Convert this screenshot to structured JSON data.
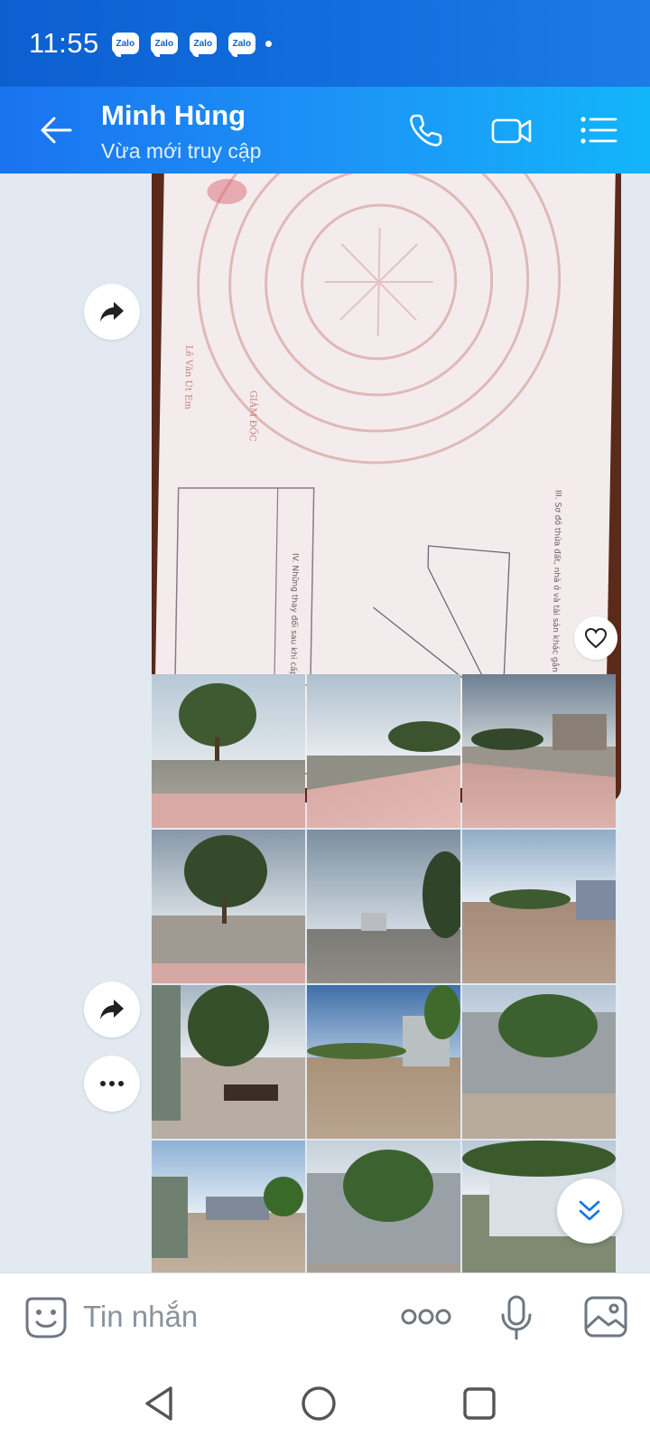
{
  "status_bar": {
    "time": "11:55",
    "notification_icons": [
      "Zalo",
      "Zalo",
      "Zalo",
      "Zalo"
    ]
  },
  "header": {
    "contact_name": "Minh Hùng",
    "contact_status": "Vừa mới truy cập",
    "icons": [
      "back-arrow-icon",
      "phone-icon",
      "video-call-icon",
      "menu-list-icon"
    ]
  },
  "chat": {
    "messages": [
      {
        "type": "image",
        "description_icon": "document-photo",
        "reaction_icon": "heart-icon"
      },
      {
        "type": "image_grid",
        "count": 12,
        "columns": 3
      }
    ],
    "share_icon": "share-arrow-icon",
    "more_options_icon": "more-horizontal-icon",
    "scroll_icon": "double-chevron-down-icon"
  },
  "input_bar": {
    "placeholder": "Tin nhắn",
    "icons": [
      "emoji-icon",
      "more-dots-icon",
      "microphone-icon",
      "gallery-icon"
    ]
  },
  "nav_bar": {
    "icons": [
      "back-triangle-icon",
      "home-circle-icon",
      "recents-square-icon"
    ]
  },
  "colors": {
    "status_bar": "#0d5fd0",
    "header_start": "#1a73f0",
    "header_end": "#12b5fa",
    "chat_bg": "#e2e9f1"
  }
}
